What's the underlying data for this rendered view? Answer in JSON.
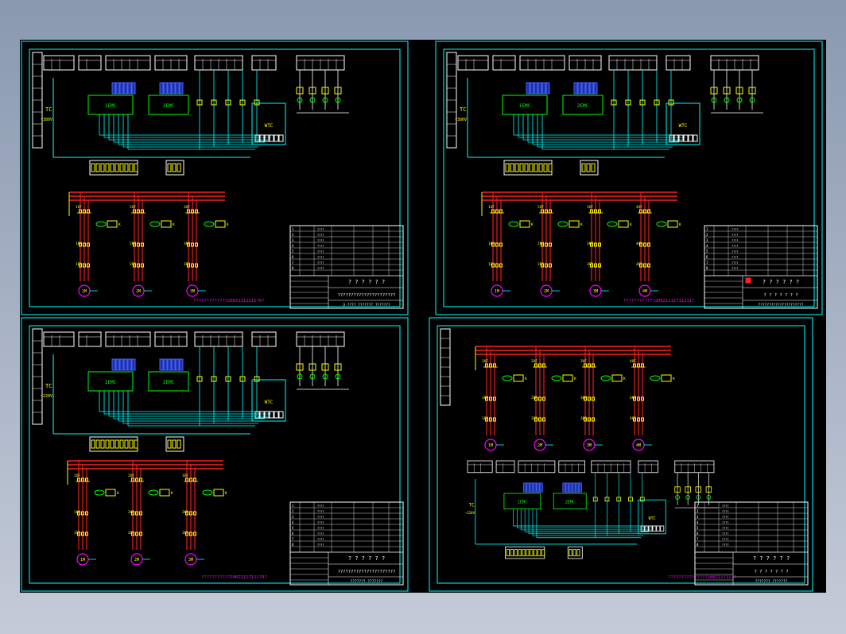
{
  "colors": {
    "frame": "#00ffff",
    "wire": "#00ffff",
    "power": "#ff2020",
    "component": "#ffff00",
    "label": "#ffff00",
    "motor": "#ff00ff",
    "table": "#ffffff",
    "green": "#00ff00",
    "background": "#000000"
  },
  "sheets": [
    {
      "id": "sheet-top-left",
      "modules": [
        "1EMC",
        "2EMC",
        "WTC"
      ],
      "motor_labels": [
        "1M",
        "2M",
        "3M"
      ],
      "supply_label": "~380V",
      "tc_label": "TC",
      "footer": "?????????????200Z1111211?6?",
      "title_block": [
        "? ? ? ? ? ?",
        "??????????????????????",
        "3 ???? ???????  ???????"
      ]
    },
    {
      "id": "sheet-top-right",
      "modules": [
        "1EMC",
        "2EMC",
        "WTC"
      ],
      "motor_labels": [
        "1M",
        "2M",
        "3M",
        "4M"
      ],
      "supply_label": "~380V",
      "tc_label": "TC",
      "footer": "????????????200Z1112711211?",
      "title_block": [
        "? ? ? ? ? ?",
        "? ? ? ? ? ? ?",
        "?????????????????????"
      ]
    },
    {
      "id": "sheet-bottom-left",
      "modules": [
        "1EMC",
        "2EMC",
        "WTC"
      ],
      "motor_labels": [
        "1M",
        "2M",
        "3M"
      ],
      "supply_label": "~220V",
      "tc_label": "TC",
      "footer": "???????????200Z1117111?9?",
      "title_block": [
        "? ? ? ? ? ?",
        "??????????????????????",
        "??????? ???????"
      ]
    },
    {
      "id": "sheet-bottom-right",
      "modules": [
        "1EMC",
        "2EMC",
        "WTC"
      ],
      "motor_labels": [
        "1M",
        "2M",
        "3M",
        "4M"
      ],
      "supply_label": "~220V",
      "tc_label": "TC",
      "footer": "???????????????200Z11?11??",
      "title_block": [
        "? ? ? ? ? ?",
        "? ? ? ? ? ? ?",
        "??????? ???????"
      ]
    }
  ]
}
